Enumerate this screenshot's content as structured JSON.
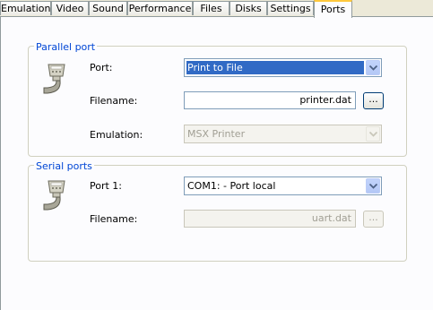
{
  "tabs": [
    {
      "label": "Emulation",
      "active": false
    },
    {
      "label": "Video",
      "active": false
    },
    {
      "label": "Sound",
      "active": false
    },
    {
      "label": "Performance",
      "active": false
    },
    {
      "label": "Files",
      "active": false
    },
    {
      "label": "Disks",
      "active": false
    },
    {
      "label": "Settings",
      "active": false
    },
    {
      "label": "Ports",
      "active": true
    }
  ],
  "parallel": {
    "title": "Parallel port",
    "port_label": "Port:",
    "port_value": "Print to File",
    "filename_label": "Filename:",
    "filename_value": "printer.dat",
    "browse_label": "...",
    "emulation_label": "Emulation:",
    "emulation_value": "MSX Printer",
    "icon": "parallel-port-connector-icon"
  },
  "serial": {
    "title": "Serial ports",
    "port_label": "Port 1:",
    "port_value": "COM1: - Port local",
    "filename_label": "Filename:",
    "filename_value": "uart.dat",
    "browse_label": "...",
    "icon": "serial-port-connector-icon"
  },
  "colors": {
    "group_title": "#0046d5",
    "selection": "#316ac5",
    "active_tab_accent": "#ffc83c"
  }
}
